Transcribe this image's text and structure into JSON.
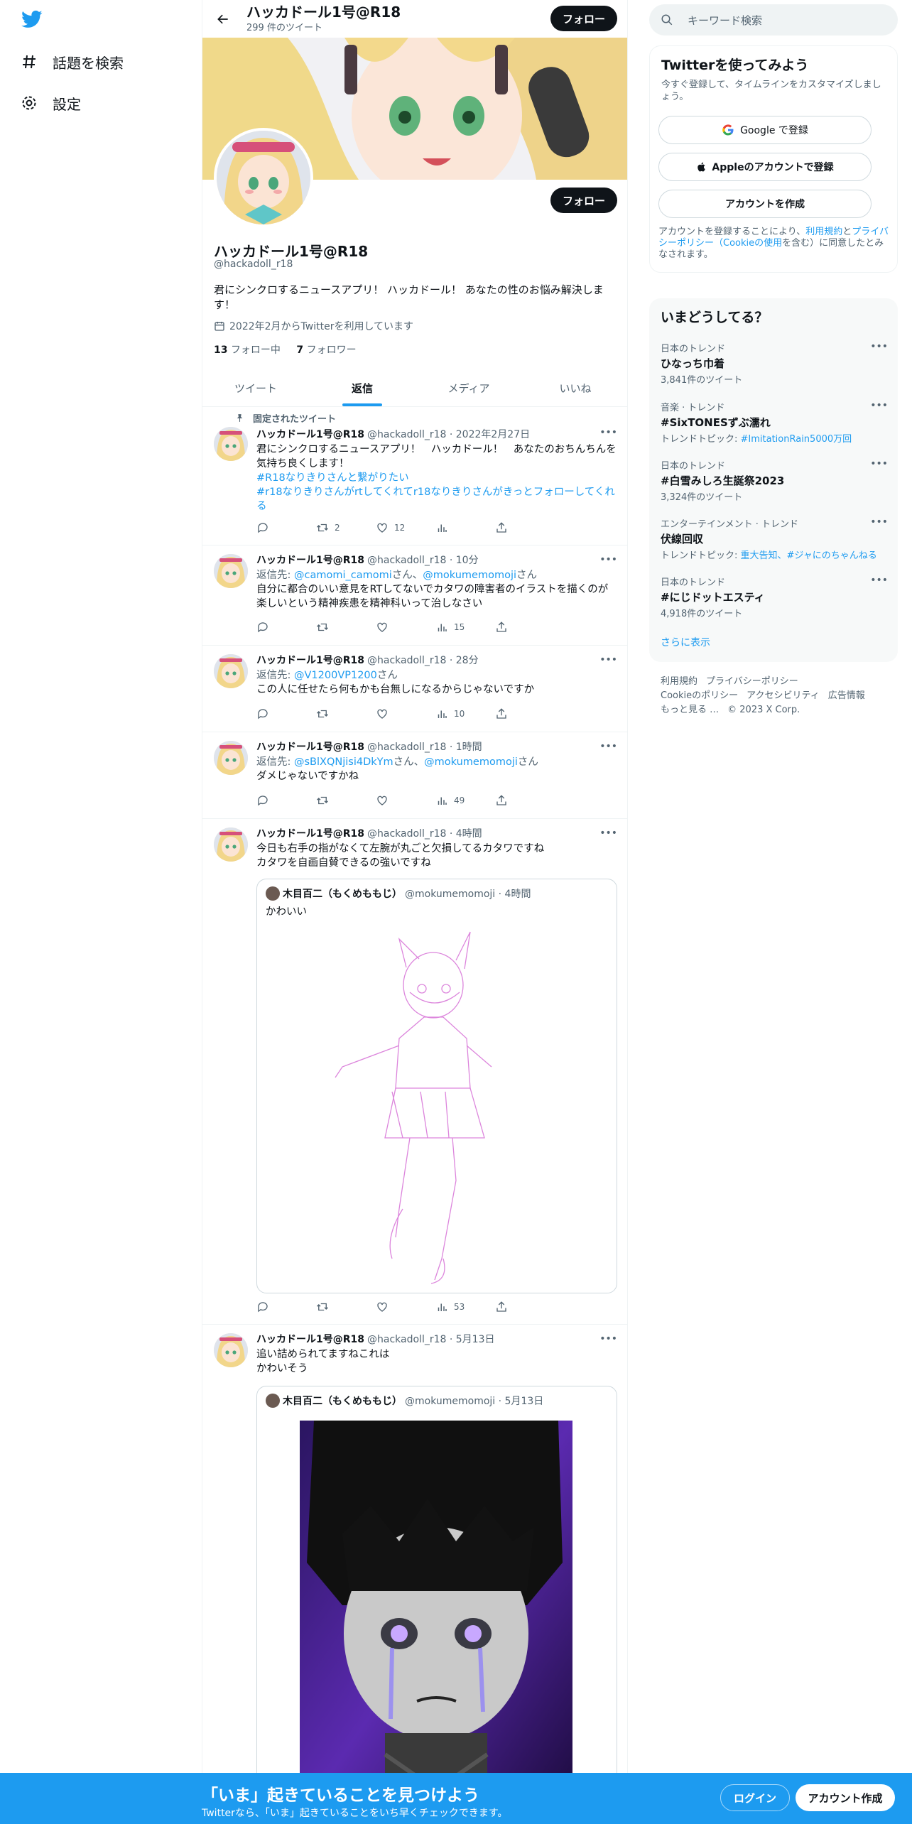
{
  "nav": {
    "explore_label": "話題を検索",
    "settings_label": "設定"
  },
  "header": {
    "name": "ハッカドール1号@R18",
    "tweet_count": "299 件のツイート",
    "follow_label": "フォロー"
  },
  "profile": {
    "name": "ハッカドール1号@R18",
    "handle": "@hackadoll_r18",
    "bio": "君にシンクロするニュースアプリ！ ハッカドール！ あなたの性のお悩み解決します！",
    "joined": "2022年2月からTwitterを利用しています",
    "following_count": "13",
    "following_label": "フォロー中",
    "followers_count": "7",
    "followers_label": "フォロワー",
    "follow_label": "フォロー"
  },
  "tabs": [
    "ツイート",
    "返信",
    "メディア",
    "いいね"
  ],
  "pinned_label": "固定されたツイート",
  "tweets": [
    {
      "name": "ハッカドール1号@R18",
      "meta": "@hackadoll_r18 · 2022年2月27日",
      "text": "君にシンクロするニュースアプリ！　ハッカドール！　あなたのおちんちんを気持ち良くします！",
      "tag1": "#R18なりきりさんと繋がりたい",
      "tag2": "#r18なりきりさんがrtしてくれてr18なりきりさんがきっとフォローしてくれる",
      "retweets": "2",
      "likes": "12"
    },
    {
      "name": "ハッカドール1号@R18",
      "meta": "@hackadoll_r18 · 10分",
      "reply_prefix": "返信先: ",
      "reply_to1": "@camomi_camomi",
      "reply_mid": "さん、",
      "reply_to2": "@mokumemomoji",
      "reply_suffix": "さん",
      "text": "自分に都合のいい意見をRTしてないでカタワの障害者のイラストを描くのが楽しいという精神疾患を精神科いって治しなさい",
      "views": "15"
    },
    {
      "name": "ハッカドール1号@R18",
      "meta": "@hackadoll_r18 · 28分",
      "reply_prefix": "返信先: ",
      "reply_to1": "@V1200VP1200",
      "reply_suffix": "さん",
      "text": "この人に任せたら何もかも台無しになるからじゃないですか",
      "views": "10"
    },
    {
      "name": "ハッカドール1号@R18",
      "meta": "@hackadoll_r18 · 1時間",
      "reply_prefix": "返信先: ",
      "reply_to1": "@sBlXQNjisi4DkYm",
      "reply_mid": "さん、",
      "reply_to2": "@mokumemomoji",
      "reply_suffix": "さん",
      "text": "ダメじゃないですかね",
      "views": "49"
    },
    {
      "name": "ハッカドール1号@R18",
      "meta": "@hackadoll_r18 · 4時間",
      "text1": "今日も右手の指がなくて左腕が丸ごと欠損してるカタワですね",
      "text2": "カタワを自画自賛できるの強いですね",
      "quote_name": "木目百二（もくめももじ）",
      "quote_meta": "@mokumemomoji · 4時間",
      "quote_text": "かわいい",
      "views": "53"
    },
    {
      "name": "ハッカドール1号@R18",
      "meta": "@hackadoll_r18 · 5月13日",
      "text1": "追い詰められてますねこれは",
      "text2": "かわいそう",
      "quote_name": "木目百二（もくめももじ）",
      "quote_meta": "@mokumemomoji · 5月13日"
    }
  ],
  "search": {
    "placeholder": "キーワード検索"
  },
  "signup": {
    "title": "Twitterを使ってみよう",
    "subtitle": "今すぐ登録して、タイムラインをカスタマイズしましょう。",
    "google": "Google で登録",
    "apple": "Appleのアカウントで登録",
    "create": "アカウントを作成",
    "legal_pre": "アカウントを登録することにより、",
    "legal_terms": "利用規約",
    "legal_and": "と",
    "legal_privacy": "プライバシーポリシー（Cookieの使用",
    "legal_post": "を含む）に同意したとみなされます。"
  },
  "trends": {
    "title": "いまどうしてる？",
    "items": [
      {
        "cat": "日本のトレンド",
        "title": "ひなっち巾着",
        "sub": "3,841件のツイート"
      },
      {
        "cat": "音楽 · トレンド",
        "title": "#SixTONESずぶ濡れ",
        "sub_pre": "トレンドトピック: ",
        "sub_link": "#ImitationRain5000万回"
      },
      {
        "cat": "日本のトレンド",
        "title": "#白雪みしろ生誕祭2023",
        "sub": "3,324件のツイート"
      },
      {
        "cat": "エンターテインメント · トレンド",
        "title": "伏線回収",
        "sub_pre": "トレンドトピック: ",
        "sub_link": "重大告知、#ジャにのちゃんねる"
      },
      {
        "cat": "日本のトレンド",
        "title": "#にじドットエスティ",
        "sub": "4,918件のツイート"
      }
    ],
    "more": "さらに表示"
  },
  "footer": {
    "terms": "利用規約",
    "privacy": "プライバシーポリシー",
    "cookie": "Cookieのポリシー",
    "access": "アクセシビリティ",
    "ads": "広告情報",
    "more": "もっと見る …",
    "copy": "© 2023 X Corp."
  },
  "bottom": {
    "title": "「いま」起きていることを見つけよう",
    "sub": "Twitterなら、「いま」起きていることをいち早くチェックできます。",
    "login": "ログイン",
    "create": "アカウント作成"
  },
  "colors": {
    "accent": "#1d9bf0",
    "text": "#0f1419",
    "muted": "#536471"
  }
}
